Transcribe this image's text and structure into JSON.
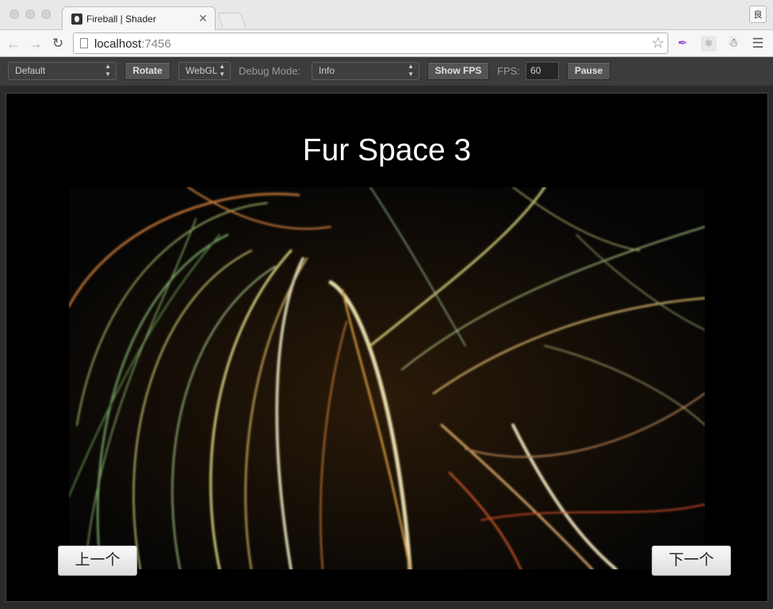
{
  "browser": {
    "tab_title": "Fireball | Shader",
    "tab_close": "✕",
    "url_host": "localhost",
    "url_port": ":7456",
    "profile_label": "良"
  },
  "controls": {
    "scene_select": "Default",
    "rotate_label": "Rotate",
    "renderer_select": "WebGL",
    "debug_label": "Debug Mode:",
    "debug_select": "Info",
    "show_fps_label": "Show FPS",
    "fps_label": "FPS:",
    "fps_value": "60",
    "pause_label": "Pause"
  },
  "scene": {
    "title": "Fur Space 3",
    "prev_label": "上一个",
    "next_label": "下一个"
  },
  "icons": {
    "back": "back-arrow-icon",
    "forward": "forward-arrow-icon",
    "reload": "reload-icon",
    "bookmark": "star-icon",
    "ext1": "feather-icon",
    "ext2": "react-icon",
    "ext3": "evernote-icon",
    "menu": "hamburger-menu-icon"
  },
  "colors": {
    "control_bar": "#3c3c3c",
    "stage_bg": "#000000",
    "page_bg": "#2b2b2b"
  }
}
